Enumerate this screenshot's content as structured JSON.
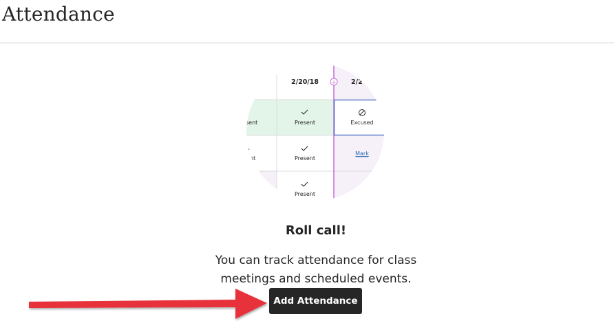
{
  "page": {
    "title": "Attendance"
  },
  "illustration": {
    "date_col_1": "2/20/18",
    "date_col_2": "2/2",
    "rows": [
      [
        "sent",
        "Present",
        "Excused"
      ],
      [
        "nt",
        "Present",
        "Mark"
      ],
      [
        "",
        "Present",
        ""
      ]
    ],
    "add_glyph": "+",
    "colors": {
      "present_bg": "#e3f5e9",
      "accent_line": "#c86dd7",
      "muted_bg": "#f6f0f8",
      "link": "#2b6cb0",
      "border_blue": "#3b5ec8"
    }
  },
  "empty_state": {
    "heading": "Roll call!",
    "description": "You can track attendance for class meetings and scheduled events.",
    "button_label": "Add Attendance"
  },
  "annotation": {
    "arrow_color": "#e8313b"
  }
}
